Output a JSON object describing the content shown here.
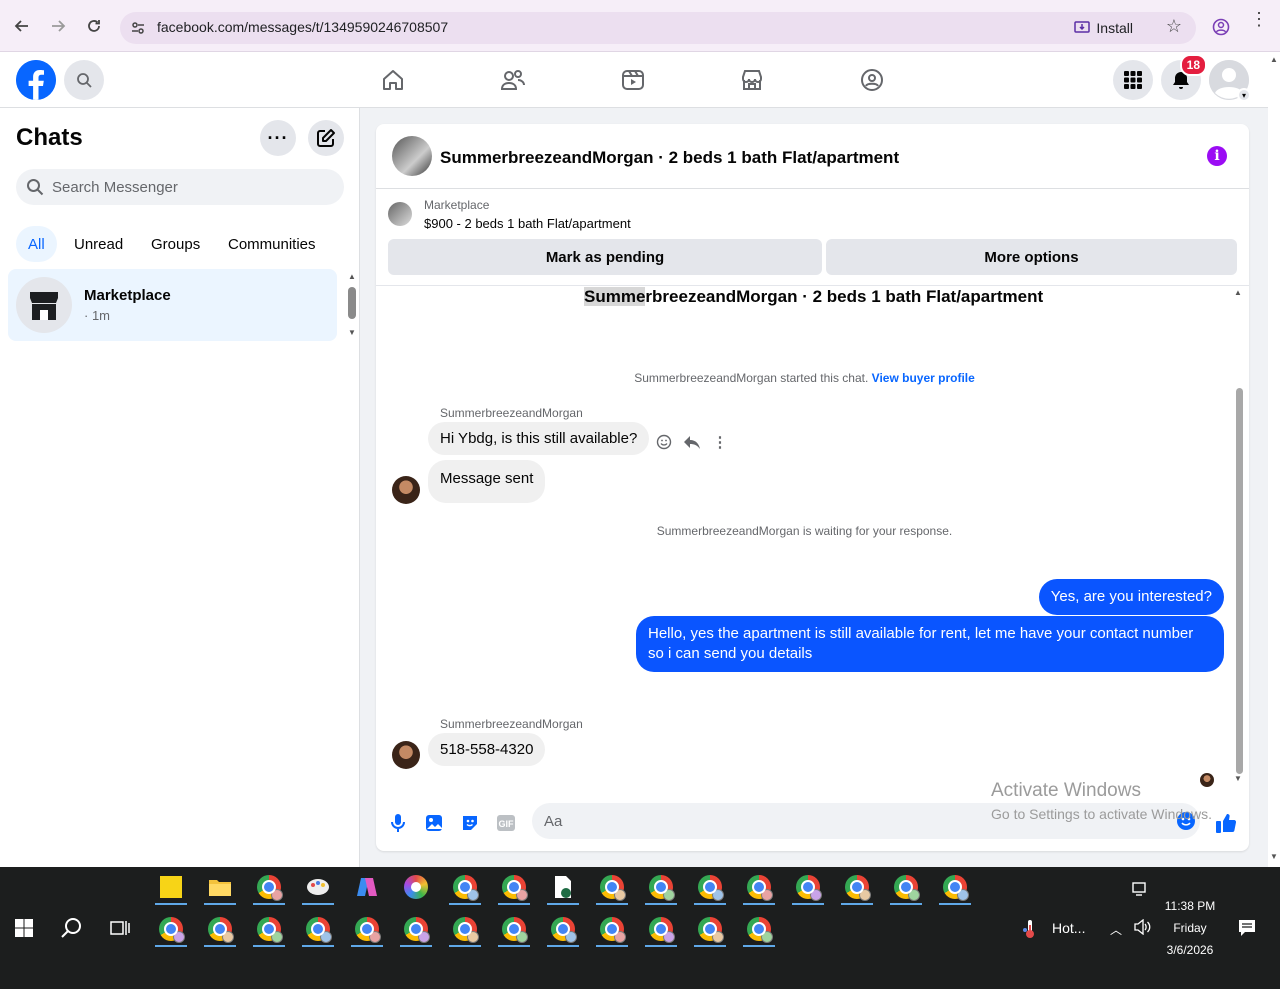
{
  "browser": {
    "url": "facebook.com/messages/t/1349590246708507",
    "install_label": "Install"
  },
  "header": {
    "notification_count": "18"
  },
  "left": {
    "title": "Chats",
    "search_placeholder": "Search Messenger",
    "tabs": [
      "All",
      "Unread",
      "Groups",
      "Communities"
    ],
    "chat": {
      "name": "Marketplace",
      "sub": "· 1m"
    }
  },
  "chat": {
    "title": "SummerbreezeandMorgan · 2 beds 1 bath Flat/apartment",
    "marketplace_label": "Marketplace",
    "listing_price": "$900 - 2 beds 1 bath Flat/apartment",
    "mark_pending": "Mark as pending",
    "more_options": "More options",
    "listing_title_hl": "Summe",
    "listing_title_rest": "rbreezeandMorgan · 2 beds 1 bath Flat/apartment",
    "started_text": "SummerbreezeandMorgan started this chat.",
    "view_profile": "View buyer profile",
    "sender": "SummerbreezeandMorgan",
    "msg1": "Hi Ybdg, is this still available?",
    "msg2": "Message sent",
    "waiting_text": "SummerbreezeandMorgan is waiting for your response.",
    "out1": "Yes, are you interested?",
    "out2": "Hello, yes the apartment is still available for rent, let me have your contact number so i can send you details",
    "sender2": "SummerbreezeandMorgan",
    "msg3": "518-558-4320",
    "composer_placeholder": "Aa"
  },
  "watermark": {
    "line1": "Activate Windows",
    "line2": "Go to Settings to activate Windows."
  },
  "taskbar": {
    "weather": "Hot...",
    "time": "11:38 PM",
    "day": "Friday",
    "date": "3/6/2026"
  },
  "colors": {
    "accent": "#0866ff",
    "outgoing_bubble": "#0a55ff",
    "info": "#9b0cf4",
    "badge": "#e41e3f"
  }
}
